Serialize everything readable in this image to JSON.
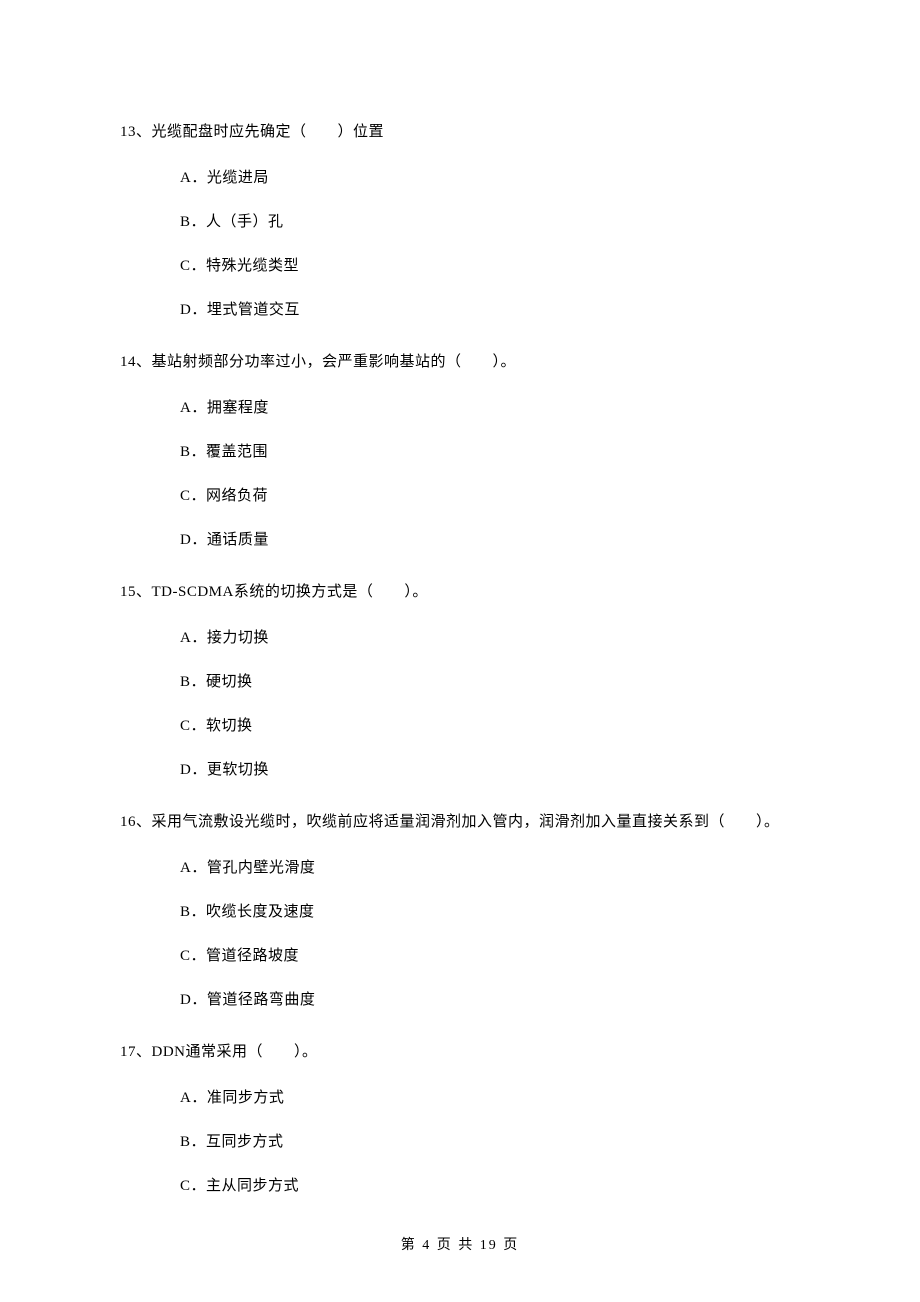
{
  "questions": [
    {
      "stem": "13、光缆配盘时应先确定（　　）位置",
      "options": [
        "A．光缆进局",
        "B．人（手）孔",
        "C．特殊光缆类型",
        "D．埋式管道交互"
      ]
    },
    {
      "stem": "14、基站射频部分功率过小，会严重影响基站的（　　）。",
      "options": [
        "A．拥塞程度",
        "B．覆盖范围",
        "C．网络负荷",
        "D．通话质量"
      ]
    },
    {
      "stem": "15、TD-SCDMA系统的切换方式是（　　）。",
      "options": [
        "A．接力切换",
        "B．硬切换",
        "C．软切换",
        "D．更软切换"
      ]
    },
    {
      "stem": "16、采用气流敷设光缆时，吹缆前应将适量润滑剂加入管内，润滑剂加入量直接关系到（　　）。",
      "options": [
        "A．管孔内壁光滑度",
        "B．吹缆长度及速度",
        "C．管道径路坡度",
        "D．管道径路弯曲度"
      ]
    },
    {
      "stem": "17、DDN通常采用（　　）。",
      "options": [
        "A．准同步方式",
        "B．互同步方式",
        "C．主从同步方式"
      ]
    }
  ],
  "footer": "第 4 页 共 19 页"
}
